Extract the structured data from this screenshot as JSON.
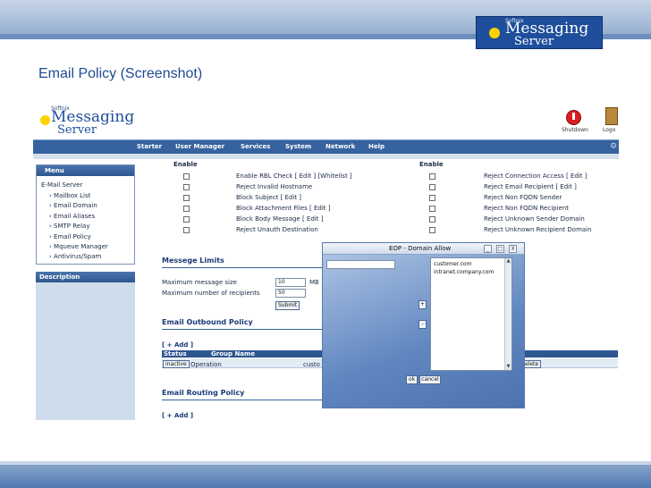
{
  "slide": {
    "title": "Email Policy (Screenshot)",
    "logo": {
      "brand": "Softnix",
      "line1": "Messaging",
      "line2": "Server"
    }
  },
  "app": {
    "logo": {
      "brand": "Softnix",
      "line1": "Messaging",
      "line2": "Server"
    },
    "header": {
      "shutdown": "Shutdown",
      "logout": "Logo"
    },
    "nav": [
      "Starter",
      "User Manager",
      "Services",
      "System",
      "Network",
      "Help"
    ],
    "menu": {
      "title": "Menu",
      "items": [
        "E-Mail Server",
        "Mailbox List",
        "Email Domain",
        "Email Aliases",
        "SMTP Relay",
        "Email Policy",
        "Mqueue Manager",
        "Antivirus/Spam"
      ]
    },
    "description_title": "Description",
    "policies": {
      "enable_header": "Enable",
      "left": [
        {
          "label": "Enable RBL Check",
          "extra": "[ Edit ]  [Whitelist ]"
        },
        {
          "label": "Reject Invalid Hostname",
          "extra": ""
        },
        {
          "label": "Block Subject",
          "extra": "[ Edit ]"
        },
        {
          "label": "Block Attachment Files",
          "extra": "[ Edit ]"
        },
        {
          "label": "Block Body Message",
          "extra": "[ Edit ]"
        },
        {
          "label": "Reject Unauth Destination",
          "extra": ""
        }
      ],
      "right": [
        {
          "label": "Reject Connection Access",
          "extra": "[ Edit ]"
        },
        {
          "label": "Reject Email Recipient",
          "extra": "[ Edit ]"
        },
        {
          "label": "Reject Non FQDN Sender",
          "extra": ""
        },
        {
          "label": "Reject Non FQDN Recipient",
          "extra": ""
        },
        {
          "label": "Reject Unknown Sender Domain",
          "extra": ""
        },
        {
          "label": "Reject Unknown Recipient Domain",
          "extra": ""
        }
      ]
    },
    "message_limits": {
      "title": "Messege Limits",
      "max_size_label": "Maximum message size",
      "max_size_value": "10",
      "max_size_unit": "MB",
      "max_recipients_label": "Maximum number of recipients",
      "max_recipients_value": "50",
      "submit": "Submit"
    },
    "outbound": {
      "title": "Email Outbound Policy",
      "add": "[ + Add ]",
      "columns": [
        "Status",
        "Group Name"
      ],
      "row": {
        "status": "inactive",
        "group": "Operation",
        "partial": "custo",
        "delete": "elete"
      }
    },
    "routing": {
      "title": "Email Routing Policy",
      "add": "[ + Add ]"
    }
  },
  "dialog": {
    "title": "EOP - Domain Allow",
    "controls": {
      "minimize": "_",
      "maximize": "□",
      "close": "X"
    },
    "list": [
      "customer.com",
      "intranet.company.com"
    ],
    "add": "+",
    "remove": "-",
    "ok": "ok",
    "cancel": "cancel"
  }
}
